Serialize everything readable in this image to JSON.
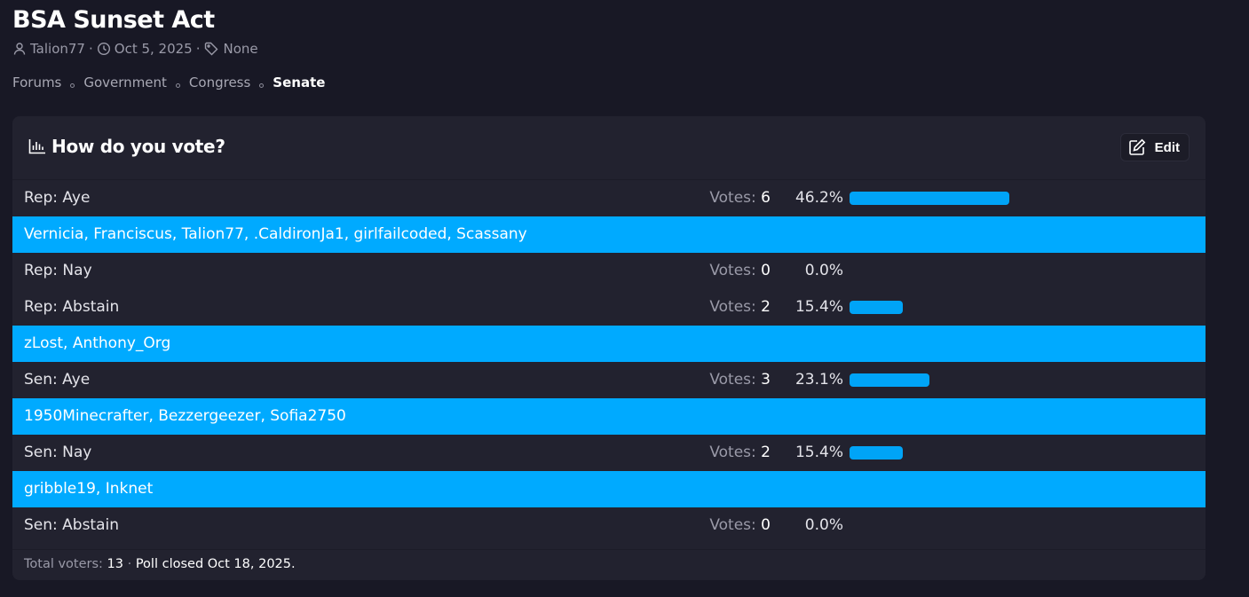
{
  "thread": {
    "title": "BSA Sunset Act",
    "author": "Talion77",
    "date": "Oct 5, 2025",
    "tags": "None",
    "meta_separator": "·"
  },
  "breadcrumb": [
    {
      "label": "Forums"
    },
    {
      "label": "Government"
    },
    {
      "label": "Congress"
    },
    {
      "label": "Senate"
    }
  ],
  "poll": {
    "question": "How do you vote?",
    "edit_label": "Edit",
    "votes_label": "Votes:",
    "accent_color": "#00aaff",
    "bar_color": "#00a4f7",
    "rows": [
      {
        "kind": "option",
        "label": "Rep: Aye",
        "votes": "6",
        "percent": "46.2%",
        "fraction": 0.462
      },
      {
        "kind": "voters",
        "names": "Vernicia, Franciscus, Talion77, .CaldironJa1, girlfailcoded, Scassany"
      },
      {
        "kind": "option",
        "label": "Rep: Nay",
        "votes": "0",
        "percent": "0.0%",
        "fraction": 0.0
      },
      {
        "kind": "option",
        "label": "Rep: Abstain",
        "votes": "2",
        "percent": "15.4%",
        "fraction": 0.154
      },
      {
        "kind": "voters",
        "names": "zLost, Anthony_Org"
      },
      {
        "kind": "option",
        "label": "Sen: Aye",
        "votes": "3",
        "percent": "23.1%",
        "fraction": 0.231
      },
      {
        "kind": "voters",
        "names": "1950Minecrafter, Bezzergeezer, Sofia2750"
      },
      {
        "kind": "option",
        "label": "Sen: Nay",
        "votes": "2",
        "percent": "15.4%",
        "fraction": 0.154
      },
      {
        "kind": "voters",
        "names": "gribble19, Inknet"
      },
      {
        "kind": "option",
        "label": "Sen: Abstain",
        "votes": "0",
        "percent": "0.0%",
        "fraction": 0.0
      }
    ],
    "footer": {
      "total_label": "Total voters:",
      "total_value": "13",
      "separator": "·",
      "closed_text": "Poll closed Oct 18, 2025."
    }
  }
}
